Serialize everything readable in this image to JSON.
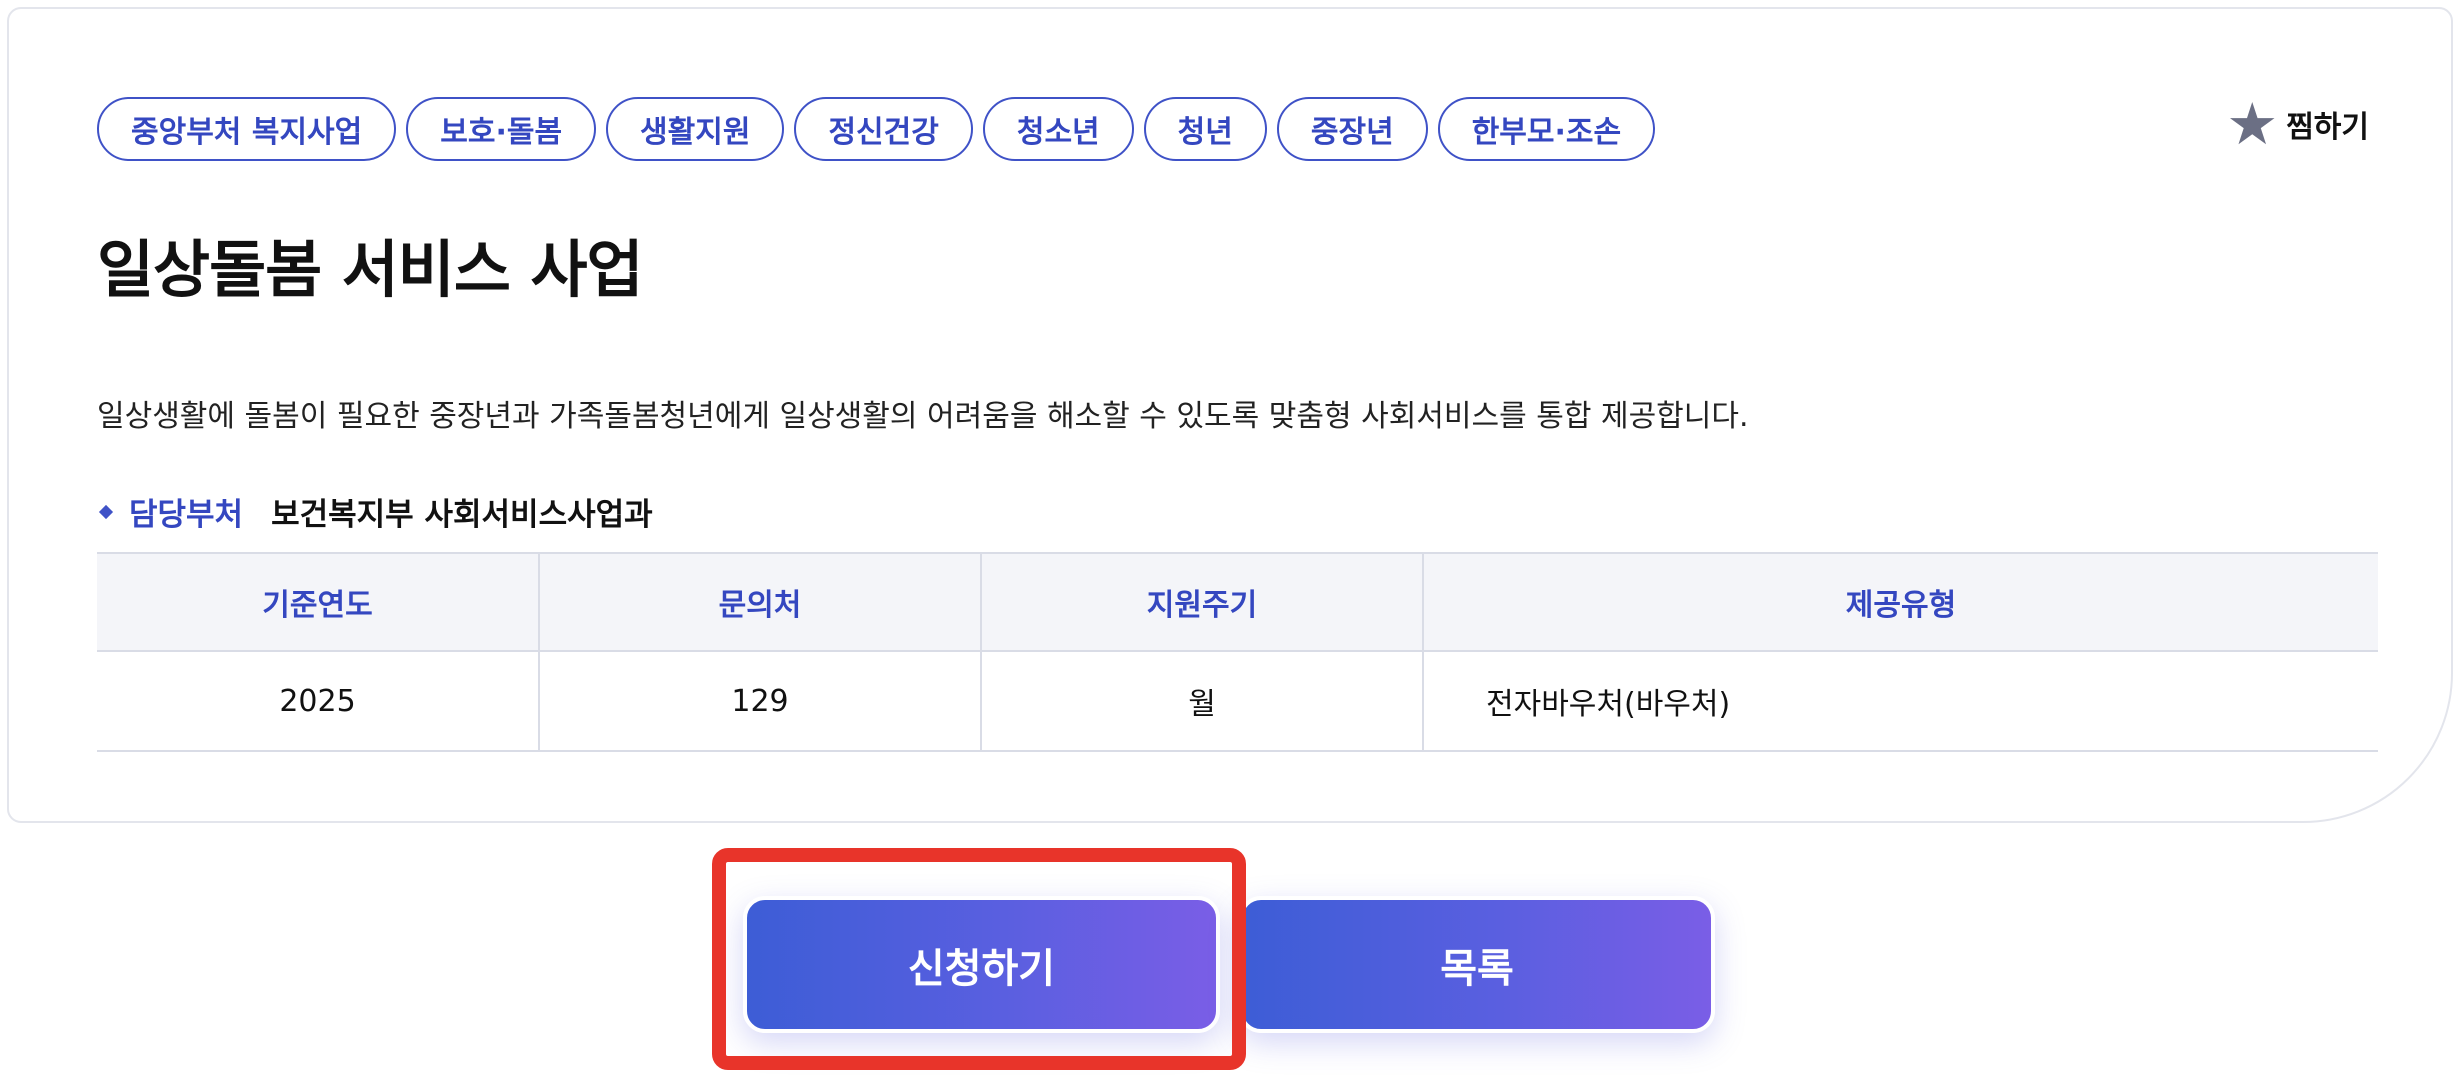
{
  "tags": [
    "중앙부처 복지사업",
    "보호·돌봄",
    "생활지원",
    "정신건강",
    "청소년",
    "청년",
    "중장년",
    "한부모·조손"
  ],
  "favorite": {
    "icon": "star-icon",
    "label": "찜하기"
  },
  "title": "일상돌봄 서비스 사업",
  "description": "일상생활에 돌봄이 필요한 중장년과 가족돌봄청년에게 일상생활의 어려움을 해소할 수 있도록 맞춤형 사회서비스를 통합 제공합니다.",
  "department": {
    "label": "담당부처",
    "value": "보건복지부 사회서비스사업과"
  },
  "table": {
    "headers": [
      "기준연도",
      "문의처",
      "지원주기",
      "제공유형"
    ],
    "row": [
      "2025",
      "129",
      "월",
      "전자바우처(바우처)"
    ]
  },
  "buttons": {
    "apply": "신청하기",
    "list": "목록"
  },
  "colors": {
    "accent": "#3447c0",
    "highlight": "#e8342a"
  }
}
